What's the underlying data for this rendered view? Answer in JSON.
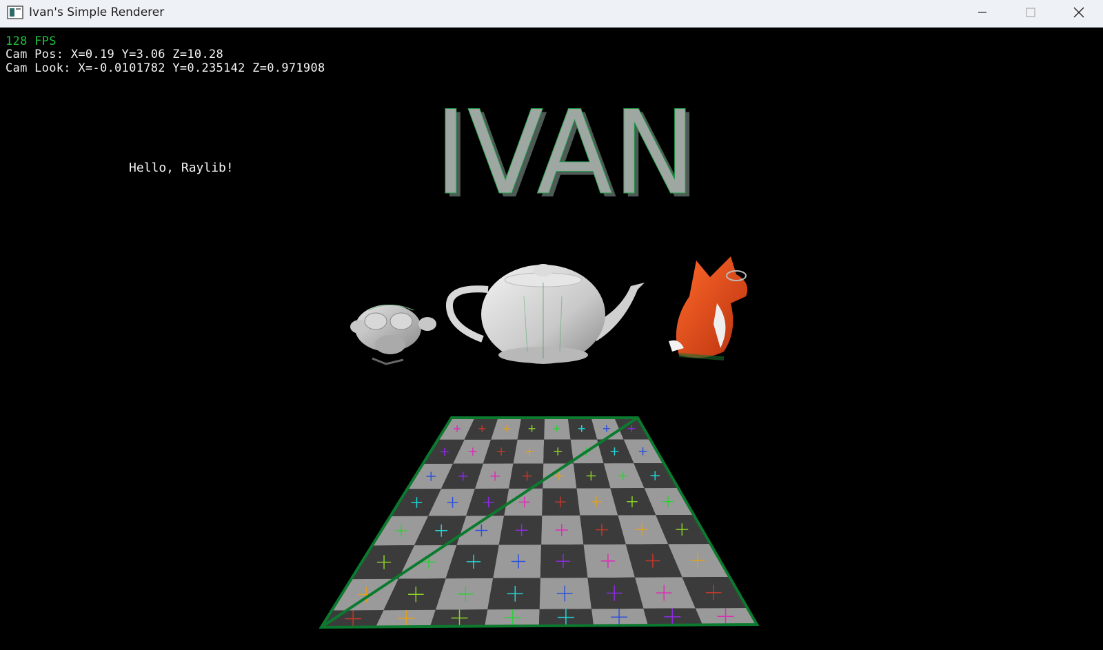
{
  "window": {
    "title": "Ivan's Simple Renderer"
  },
  "hud": {
    "fps": "128 FPS",
    "cam_pos": "Cam Pos: X=0.19 Y=3.06 Z=10.28",
    "cam_look": "Cam Look: X=-0.0101782 Y=0.235142 Z=0.971908"
  },
  "scene": {
    "greeting": "Hello, Raylib!",
    "title_3d": "IVAN",
    "colors": {
      "hud_fps": "#1ec13a",
      "hud_text": "#f4f4f4",
      "floor_light": "#9a9a9a",
      "floor_dark": "#3b3b3b",
      "floor_outline": "#0b7a2f",
      "fox": "#e0471c"
    }
  }
}
